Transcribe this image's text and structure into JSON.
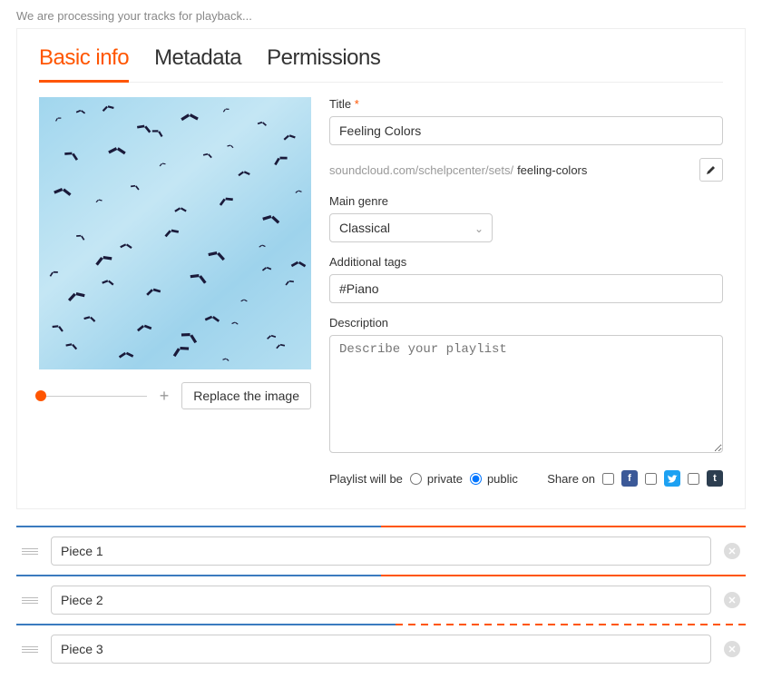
{
  "banner": "We are processing your tracks for playback...",
  "tabs": {
    "basic": "Basic info",
    "meta": "Metadata",
    "perm": "Permissions"
  },
  "form": {
    "title_label": "Title",
    "title_value": "Feeling Colors",
    "url_prefix": "soundcloud.com/schelpcenter/sets/",
    "url_slug": "feeling-colors",
    "genre_label": "Main genre",
    "genre_value": "Classical",
    "tags_label": "Additional tags",
    "tags_value": "#Piano",
    "desc_label": "Description",
    "desc_placeholder": "Describe your playlist",
    "replace_btn": "Replace the image"
  },
  "footer": {
    "privacy_label": "Playlist will be",
    "private": "private",
    "public": "public",
    "share_label": "Share on"
  },
  "tracks": [
    {
      "name": "Piece 1",
      "blue": 50,
      "orange_style": "solid"
    },
    {
      "name": "Piece 2",
      "blue": 50,
      "orange_style": "solid"
    },
    {
      "name": "Piece 3",
      "blue": 52,
      "orange_style": "dashed"
    }
  ]
}
